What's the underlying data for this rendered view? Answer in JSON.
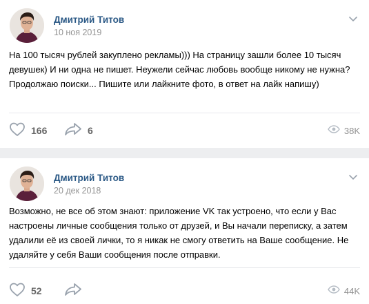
{
  "posts": [
    {
      "author": "Дмитрий Титов",
      "date": "10 ноя 2019",
      "text": "На 100 тысяч рублей закуплено рекламы))) На страницу зашли более 10 тысяч девушек) И ни одна не пишет. Неужели сейчас любовь вообще никому не нужна? Продолжаю поиски... Пишите или лайкните фото, в ответ на лайк напишу)",
      "likes": "166",
      "shares": "6",
      "views": "38K"
    },
    {
      "author": "Дмитрий Титов",
      "date": "20 дек 2018",
      "text": "Возможно, не все об этом знают: приложение VK так устроено, что если у Вас настроены личные сообщения только от друзей, и Вы начали переписку, а затем удалили её из своей лички, то я никак не смогу ответить на Ваше сообщение. Не удаляйте у себя Ваши сообщения после отправки.",
      "likes": "52",
      "shares": "",
      "views": "44K"
    }
  ],
  "icons": {
    "like": "heart-icon",
    "share": "share-arrow-icon",
    "views": "eye-icon",
    "more": "chevron-down-icon"
  },
  "colors": {
    "author": "#2a5885",
    "meta": "#939393",
    "icon": "#99a2ad",
    "separator": "#e7e8ec",
    "background": "#edeef0"
  }
}
